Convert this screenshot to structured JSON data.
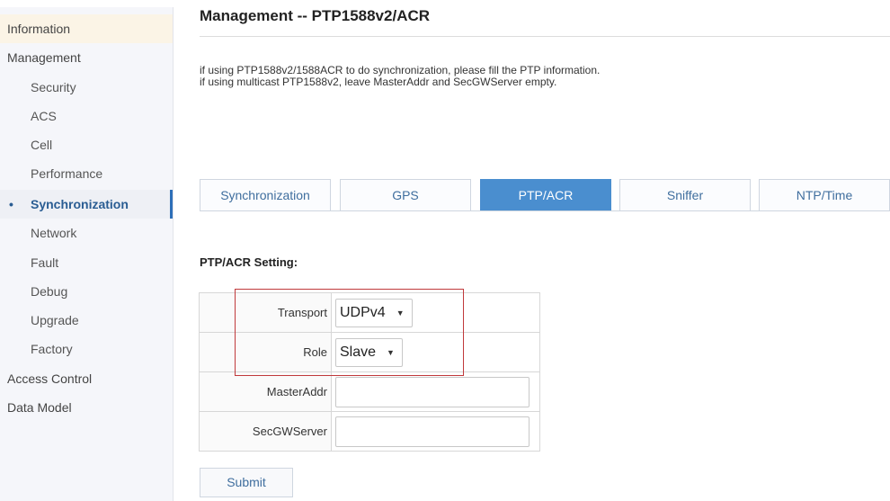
{
  "sidebar": {
    "items": [
      {
        "label": "Information"
      },
      {
        "label": "Management"
      },
      {
        "label": "Security"
      },
      {
        "label": "ACS"
      },
      {
        "label": "Cell"
      },
      {
        "label": "Performance"
      },
      {
        "label": "Synchronization",
        "marker": "•"
      },
      {
        "label": "Network"
      },
      {
        "label": "Fault"
      },
      {
        "label": "Debug"
      },
      {
        "label": "Upgrade"
      },
      {
        "label": "Factory"
      },
      {
        "label": "Access Control"
      },
      {
        "label": "Data Model"
      }
    ]
  },
  "page": {
    "title": "Management -- PTP1588v2/ACR",
    "info_line1": "if using PTP1588v2/1588ACR to do synchronization, please fill the PTP information.",
    "info_line2": "if using multicast PTP1588v2, leave MasterAddr and SecGWServer empty."
  },
  "tabs": [
    {
      "label": "Synchronization"
    },
    {
      "label": "GPS"
    },
    {
      "label": "PTP/ACR"
    },
    {
      "label": "Sniffer"
    },
    {
      "label": "NTP/Time"
    }
  ],
  "form": {
    "section_title": "PTP/ACR Setting:",
    "transport_label": "Transport",
    "transport_value": "UDPv4",
    "role_label": "Role",
    "role_value": "Slave",
    "masteraddr_label": "MasterAddr",
    "masteraddr_value": "",
    "secgw_label": "SecGWServer",
    "secgw_value": "",
    "dropdown_arrow": "▼",
    "submit_label": "Submit"
  },
  "colors": {
    "accent": "#4a8ecf",
    "active_nav": "#2a5d93",
    "highlight_box": "#c0393b"
  }
}
